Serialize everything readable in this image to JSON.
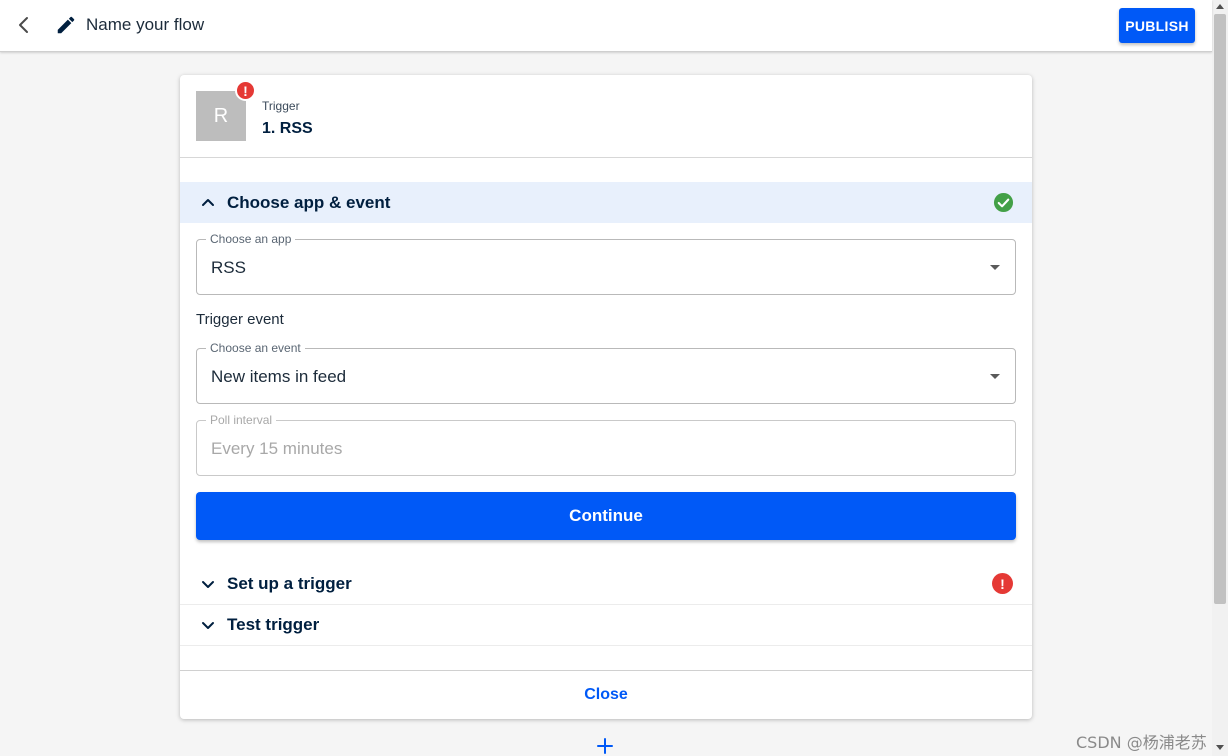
{
  "header": {
    "flow_name": "Name your flow",
    "publish_label": "PUBLISH"
  },
  "step": {
    "avatar_letter": "R",
    "error_badge": "!",
    "type_label": "Trigger",
    "title": "1. RSS"
  },
  "sections": {
    "choose_app_event": "Choose app & event",
    "set_up_trigger": "Set up a trigger",
    "test_trigger": "Test trigger"
  },
  "form": {
    "app_field": {
      "label": "Choose an app",
      "value": "RSS"
    },
    "trigger_event_heading": "Trigger event",
    "event_field": {
      "label": "Choose an event",
      "value": "New items in feed"
    },
    "poll_field": {
      "label": "Poll interval",
      "value": "Every 15 minutes"
    },
    "continue_label": "Continue"
  },
  "footer": {
    "close_label": "Close"
  },
  "watermark": "CSDN @杨浦老苏",
  "colors": {
    "accent": "#0059f7",
    "success": "#43a047",
    "error": "#e53935",
    "section_highlight": "#e8f0fc"
  },
  "icons": [
    "back-chevron-icon",
    "pencil-icon",
    "check-circle-icon",
    "error-icon",
    "chevron-up-icon",
    "chevron-down-icon",
    "plus-icon"
  ]
}
